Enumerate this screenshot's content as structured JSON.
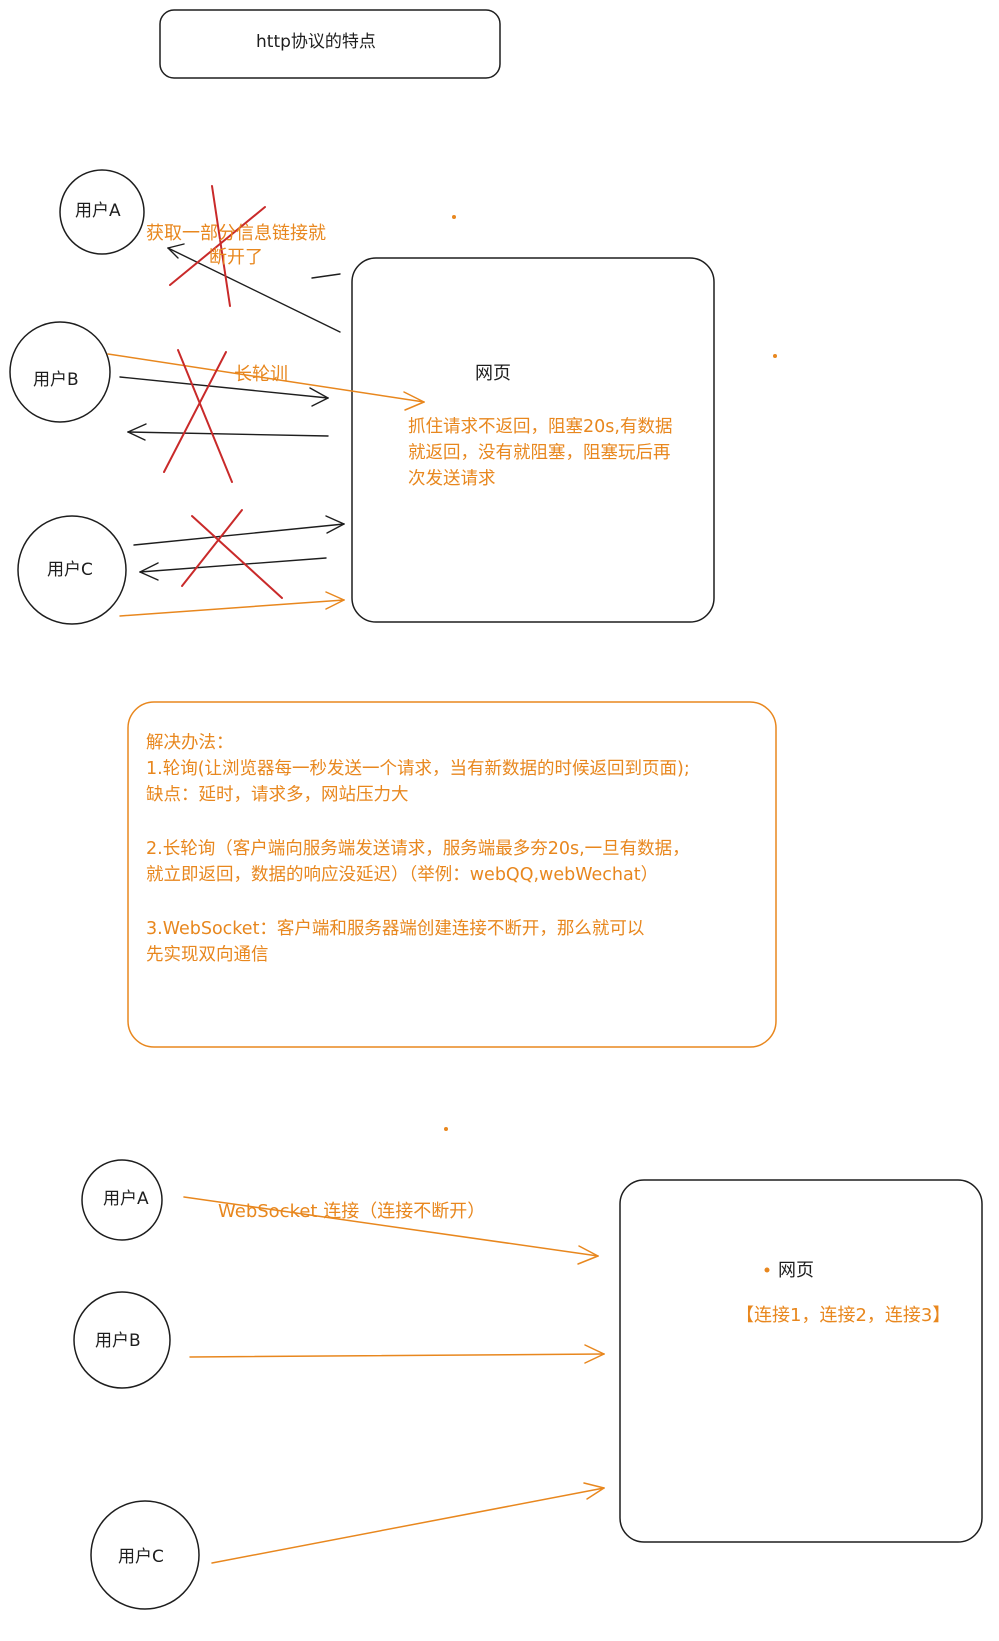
{
  "title": "http协议的特点",
  "section1": {
    "users": [
      "用户A",
      "用户B",
      "用户C"
    ],
    "webpage": "网页",
    "label_disconnect": "获取一部分信息链接就\n断开了",
    "label_long_poll": "长轮训",
    "note": "抓住请求不返回，阻塞20s,有数据\n就返回，没有就阻塞，阻塞玩后再\n次发送请求"
  },
  "solutions": {
    "heading": "解决办法：",
    "item1": "1.轮询(让浏览器每一秒发送一个请求，当有新数据的时候返回到页面);\n缺点：延时，请求多，网站压力大",
    "item2": "2.长轮询（客户端向服务端发送请求，服务端最多夯20s,一旦有数据，\n就立即返回，数据的响应没延迟）（举例：webQQ,webWechat）",
    "item3": "3.WebSocket：客户端和服务器端创建连接不断开，那么就可以\n先实现双向通信"
  },
  "section2": {
    "users": [
      "用户A",
      "用户B",
      "用户C"
    ],
    "connection_label": "WebSocket 连接（连接不断开）",
    "webpage": "网页",
    "connections": "【连接1，连接2，连接3】"
  },
  "colors": {
    "stroke": "#1e1e1e",
    "accent": "#e8871e",
    "cross": "#c92a2a"
  }
}
